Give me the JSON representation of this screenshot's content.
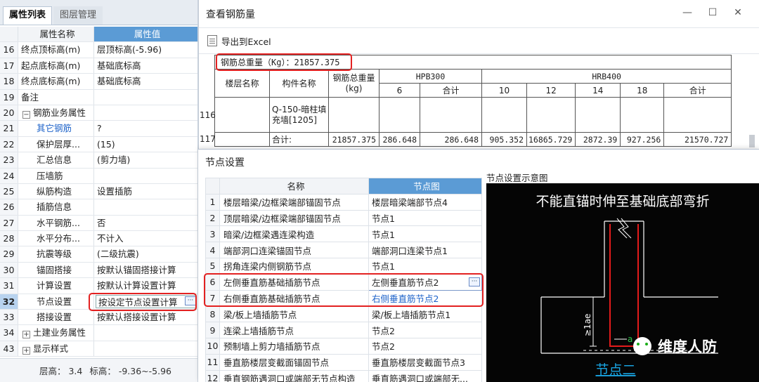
{
  "left_panel": {
    "tabs": [
      "属性列表",
      "图层管理"
    ],
    "header": {
      "name": "属性名称",
      "value": "属性值"
    },
    "rows": [
      {
        "num": "16",
        "name": "终点顶标高(m)",
        "value": "层顶标高(-5.96)"
      },
      {
        "num": "17",
        "name": "起点底标高(m)",
        "value": "基础底标高"
      },
      {
        "num": "18",
        "name": "终点底标高(m)",
        "value": "基础底标高"
      },
      {
        "num": "19",
        "name": "备注",
        "value": ""
      },
      {
        "num": "20",
        "name": "钢筋业务属性",
        "value": ""
      },
      {
        "num": "21",
        "name": "其它钢筋",
        "value": "?"
      },
      {
        "num": "22",
        "name": "保护层厚...",
        "value": "(15)"
      },
      {
        "num": "23",
        "name": "汇总信息",
        "value": "(剪力墙)"
      },
      {
        "num": "24",
        "name": "压墙筋",
        "value": ""
      },
      {
        "num": "25",
        "name": "纵筋构造",
        "value": "设置插筋"
      },
      {
        "num": "26",
        "name": "插筋信息",
        "value": ""
      },
      {
        "num": "27",
        "name": "水平钢筋...",
        "value": "否"
      },
      {
        "num": "28",
        "name": "水平分布...",
        "value": "不计入"
      },
      {
        "num": "29",
        "name": "抗震等级",
        "value": "(二级抗震)"
      },
      {
        "num": "30",
        "name": "锚固搭接",
        "value": "按默认锚固搭接计算"
      },
      {
        "num": "31",
        "name": "计算设置",
        "value": "按默认计算设置计算"
      },
      {
        "num": "32",
        "name": "节点设置",
        "value": "按设定节点设置计算"
      },
      {
        "num": "33",
        "name": "搭接设置",
        "value": "按默认搭接设置计算"
      },
      {
        "num": "34",
        "name": "土建业务属性",
        "value": ""
      },
      {
        "num": "43",
        "name": "显示样式",
        "value": ""
      }
    ],
    "status": {
      "floor_height": "层高： 3.4",
      "elevation": "标高： -9.36~-5.96"
    }
  },
  "rebar_window": {
    "title": "查看钢筋量",
    "export_label": "导出到Excel",
    "total_weight": "钢筋总重量（Kg）：21857.375",
    "headers": {
      "floor": "楼层名称",
      "component": "构件名称",
      "total_weight": "钢筋总重量(kg)",
      "hpb300": "HPB300",
      "hrb400": "HRB400",
      "hpb_cols": [
        "6",
        "合计"
      ],
      "hrb_cols": [
        "10",
        "12",
        "14",
        "18",
        "合计"
      ]
    },
    "row_116": {
      "num": "116",
      "component": "Q-150-暗柱填充墙[1205]"
    },
    "row_117": {
      "num": "117",
      "label": "合计:",
      "values": [
        "21857.375",
        "286.648",
        "286.648",
        "905.352",
        "16865.729",
        "2872.39",
        "927.256",
        "21570.727"
      ]
    }
  },
  "node_window": {
    "title": "节点设置",
    "header": {
      "name": "名称",
      "value": "节点图"
    },
    "rows": [
      {
        "num": "1",
        "name": "楼层暗梁/边框梁端部锚固节点",
        "value": "楼层暗梁端部节点4"
      },
      {
        "num": "2",
        "name": "顶层暗梁/边框梁端部锚固节点",
        "value": "节点1"
      },
      {
        "num": "3",
        "name": "暗梁/边框梁遇连梁构造",
        "value": "节点1"
      },
      {
        "num": "4",
        "name": "端部洞口连梁锚固节点",
        "value": "端部洞口连梁节点1"
      },
      {
        "num": "5",
        "name": "拐角连梁内侧钢筋节点",
        "value": "节点1"
      },
      {
        "num": "6",
        "name": "左侧垂直筋基础插筋节点",
        "value": "左侧垂直筋节点2"
      },
      {
        "num": "7",
        "name": "右侧垂直筋基础插筋节点",
        "value": "右侧垂直筋节点2"
      },
      {
        "num": "8",
        "name": "梁/板上墙插筋节点",
        "value": "梁/板上墙插筋节点1"
      },
      {
        "num": "9",
        "name": "连梁上墙插筋节点",
        "value": "节点2"
      },
      {
        "num": "10",
        "name": "预制墙上剪力墙插筋节点",
        "value": "节点2"
      },
      {
        "num": "11",
        "name": "垂直筋楼层变截面锚固节点",
        "value": "垂直筋楼层变截面节点3"
      },
      {
        "num": "12",
        "name": "垂直钢筋遇洞口或端部无节点构造",
        "value": "垂直筋遇洞口或端部无..."
      }
    ],
    "diagram": {
      "title": "节点设置示意图",
      "caption": "不能直锚时伸至基础底部弯折",
      "dim_label": "≥1ae",
      "dim_small": "a",
      "node_label": "节点二",
      "watermark": "维度人防"
    }
  },
  "colors": {
    "header_blue": "#5b9bd5",
    "highlight_red": "#e32121",
    "link_blue": "#1c62c9",
    "diagram_bg": "#050505"
  }
}
